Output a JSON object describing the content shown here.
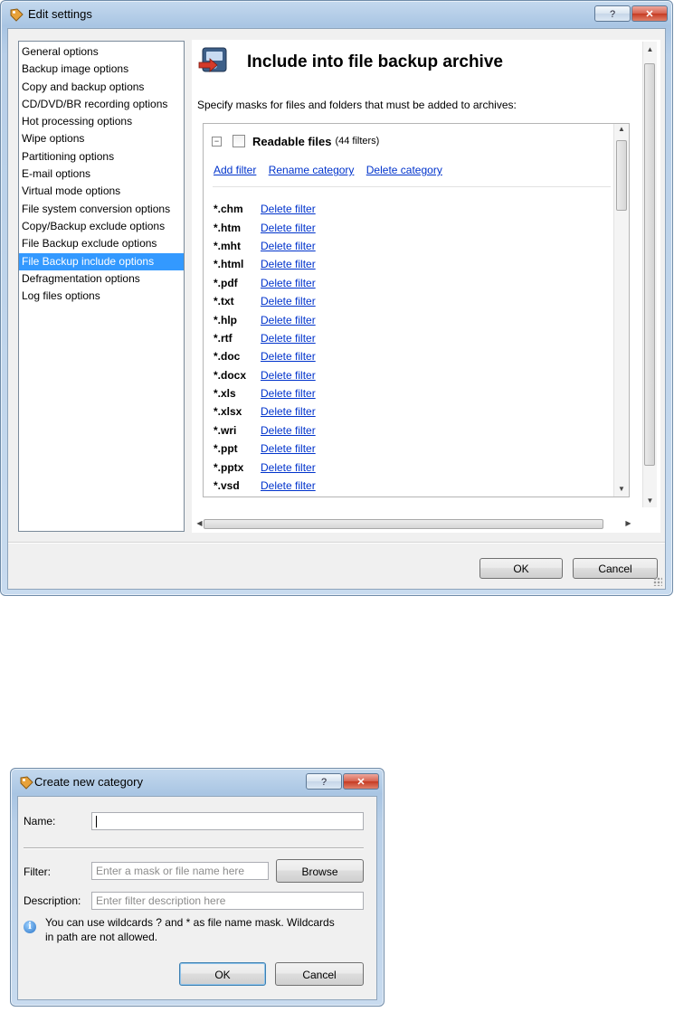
{
  "edit_settings": {
    "title": "Edit settings",
    "help_label": "?",
    "close_label": "✕",
    "nav_items": [
      {
        "label": "General options"
      },
      {
        "label": "Backup image options"
      },
      {
        "label": "Copy and backup options"
      },
      {
        "label": "CD/DVD/BR recording options"
      },
      {
        "label": "Hot processing options"
      },
      {
        "label": "Wipe options"
      },
      {
        "label": "Partitioning options"
      },
      {
        "label": "E-mail options"
      },
      {
        "label": "Virtual mode options"
      },
      {
        "label": "File system conversion options"
      },
      {
        "label": "Copy/Backup exclude options"
      },
      {
        "label": "File Backup exclude options"
      },
      {
        "label": "File Backup include options",
        "selected": true
      },
      {
        "label": "Defragmentation options"
      },
      {
        "label": "Log files options"
      }
    ],
    "header_title": "Include into file backup archive",
    "instruction": "Specify masks for  files and folders that must be added to archives:",
    "category": {
      "name": "Readable files",
      "count": "(44 filters)",
      "collapse_symbol": "−",
      "links": {
        "add": "Add filter",
        "rename": "Rename category",
        "delete": "Delete category"
      }
    },
    "filters": [
      {
        "mask": "*.chm",
        "action": "Delete filter"
      },
      {
        "mask": "*.htm",
        "action": "Delete filter"
      },
      {
        "mask": "*.mht",
        "action": "Delete filter"
      },
      {
        "mask": "*.html",
        "action": "Delete filter"
      },
      {
        "mask": "*.pdf",
        "action": "Delete filter"
      },
      {
        "mask": "*.txt",
        "action": "Delete filter"
      },
      {
        "mask": "*.hlp",
        "action": "Delete filter"
      },
      {
        "mask": "*.rtf",
        "action": "Delete filter"
      },
      {
        "mask": "*.doc",
        "action": "Delete filter"
      },
      {
        "mask": "*.docx",
        "action": "Delete filter"
      },
      {
        "mask": "*.xls",
        "action": "Delete filter"
      },
      {
        "mask": "*.xlsx",
        "action": "Delete filter"
      },
      {
        "mask": "*.wri",
        "action": "Delete filter"
      },
      {
        "mask": "*.ppt",
        "action": "Delete filter"
      },
      {
        "mask": "*.pptx",
        "action": "Delete filter"
      },
      {
        "mask": "*.vsd",
        "action": "Delete filter"
      }
    ],
    "ok_label": "OK",
    "cancel_label": "Cancel"
  },
  "create_category": {
    "title": "Create new category",
    "help_label": "?",
    "close_label": "✕",
    "name_label": "Name:",
    "name_value": "",
    "filter_label": "Filter:",
    "filter_placeholder": "Enter a mask or file name here",
    "browse_label": "Browse",
    "description_label": "Description:",
    "description_placeholder": "Enter filter description here",
    "info_symbol": "i",
    "info_line1": "You can use wildcards ? and * as file name mask. Wildcards",
    "info_line2": "in path are not allowed.",
    "ok_label": "OK",
    "cancel_label": "Cancel"
  },
  "colors": {
    "selection": "#3399ff",
    "link": "#0033cc",
    "title_bar": "#b8cfe8"
  },
  "icons": [
    "app-tag-icon",
    "backup-archive-icon",
    "info-icon",
    "help-icon",
    "close-icon"
  ]
}
